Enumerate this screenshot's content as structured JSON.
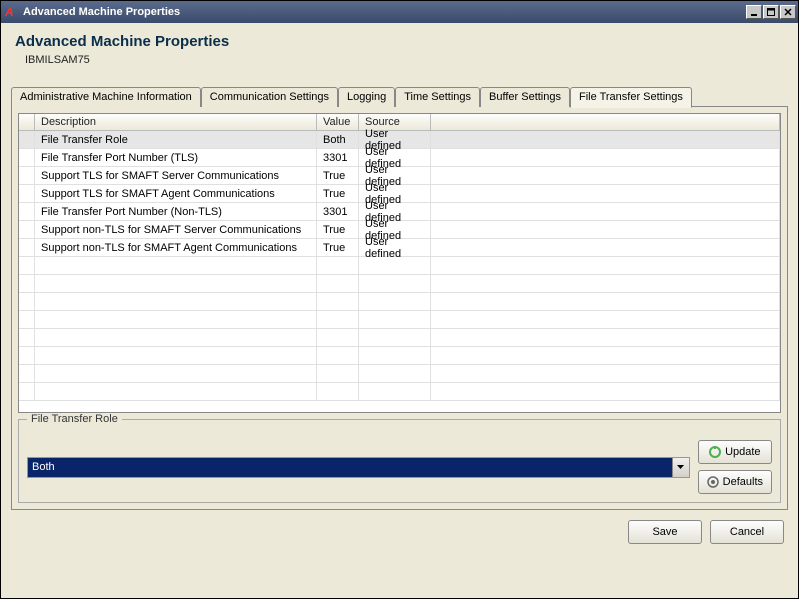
{
  "window": {
    "title": "Advanced Machine Properties"
  },
  "header": {
    "title": "Advanced Machine Properties",
    "subtitle": "IBMILSAM75"
  },
  "tabs": [
    {
      "label": "Administrative Machine Information",
      "active": false
    },
    {
      "label": "Communication Settings",
      "active": false
    },
    {
      "label": "Logging",
      "active": false
    },
    {
      "label": "Time Settings",
      "active": false
    },
    {
      "label": "Buffer Settings",
      "active": false
    },
    {
      "label": "File Transfer Settings",
      "active": true
    }
  ],
  "grid": {
    "columns": {
      "description": "Description",
      "value": "Value",
      "source": "Source"
    },
    "rows": [
      {
        "description": "File Transfer Role",
        "value": "Both",
        "source": "User defined",
        "selected": true
      },
      {
        "description": "File Transfer Port Number (TLS)",
        "value": "3301",
        "source": "User defined",
        "selected": false
      },
      {
        "description": "Support TLS for SMAFT Server Communications",
        "value": "True",
        "source": "User defined",
        "selected": false
      },
      {
        "description": "Support TLS for SMAFT Agent Communications",
        "value": "True",
        "source": "User defined",
        "selected": false
      },
      {
        "description": "File Transfer Port Number (Non-TLS)",
        "value": "3301",
        "source": "User defined",
        "selected": false
      },
      {
        "description": "Support non-TLS for SMAFT Server Communications",
        "value": "True",
        "source": "User defined",
        "selected": false
      },
      {
        "description": "Support non-TLS for SMAFT Agent Communications",
        "value": "True",
        "source": "User defined",
        "selected": false
      }
    ]
  },
  "detail": {
    "legend": "File Transfer Role",
    "value": "Both"
  },
  "buttons": {
    "update": "Update",
    "defaults": "Defaults",
    "save": "Save",
    "cancel": "Cancel"
  }
}
